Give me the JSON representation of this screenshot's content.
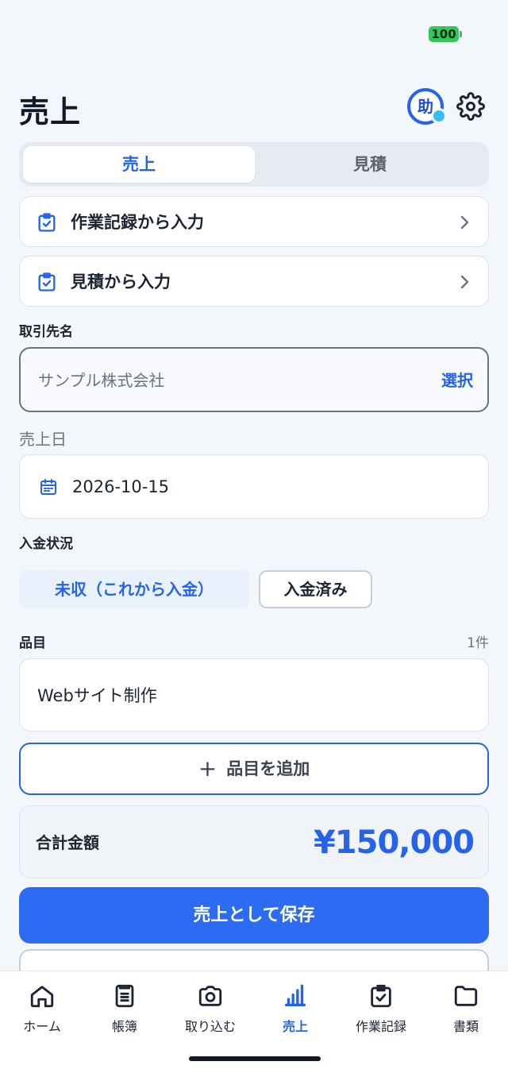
{
  "status_bar": {
    "battery": "100"
  },
  "header": {
    "title": "売上",
    "assist_label": "助"
  },
  "segment": {
    "tabs": [
      "売上",
      "見積"
    ],
    "selected": 0
  },
  "quick_inputs": [
    {
      "label": "作業記録から入力"
    },
    {
      "label": "見積から入力"
    }
  ],
  "client": {
    "label": "取引先名",
    "value": "サンプル株式会社",
    "select_label": "選択"
  },
  "sale_date": {
    "label": "売上日",
    "value": "2026-10-15"
  },
  "payment_status": {
    "label": "入金状況",
    "options": [
      "未収（これから入金）",
      "入金済み"
    ],
    "selected": 0
  },
  "items": {
    "label": "品目",
    "count": "1件",
    "rows": [
      {
        "name": "Webサイト制作"
      }
    ],
    "add_label": "品目を追加"
  },
  "total": {
    "label": "合計金額",
    "amount": "¥150,000"
  },
  "actions": {
    "save_label": "売上として保存"
  },
  "tabbar": {
    "items": [
      {
        "label": "ホーム",
        "icon": "home-icon"
      },
      {
        "label": "帳簿",
        "icon": "ledger-icon"
      },
      {
        "label": "取り込む",
        "icon": "camera-icon"
      },
      {
        "label": "売上",
        "icon": "bar-chart-icon"
      },
      {
        "label": "作業記録",
        "icon": "clipboard-check-icon"
      },
      {
        "label": "書類",
        "icon": "folder-icon"
      }
    ],
    "active": 3
  },
  "colors": {
    "accent": "#2563eb",
    "background": "#f3f6fa",
    "battery": "#34c759"
  }
}
